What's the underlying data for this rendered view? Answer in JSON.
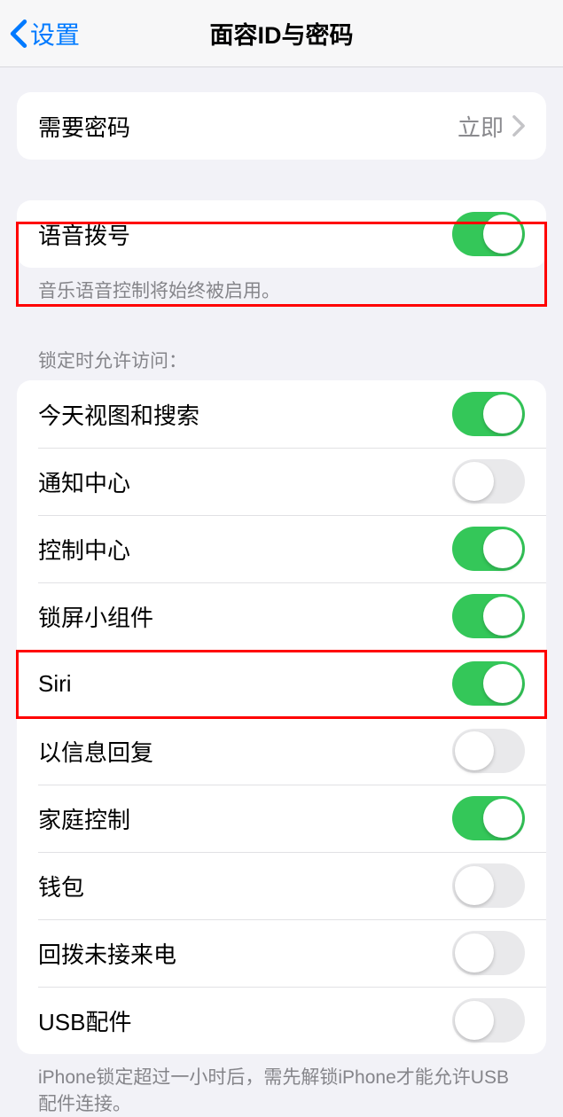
{
  "nav": {
    "back_label": "设置",
    "title": "面容ID与密码"
  },
  "passcode": {
    "label": "需要密码",
    "value": "立即"
  },
  "voice_dial": {
    "label": "语音拨号",
    "on": true,
    "footer": "音乐语音控制将始终被启用。"
  },
  "lock_access": {
    "header": "锁定时允许访问：",
    "items": [
      {
        "label": "今天视图和搜索",
        "on": true
      },
      {
        "label": "通知中心",
        "on": false
      },
      {
        "label": "控制中心",
        "on": true
      },
      {
        "label": "锁屏小组件",
        "on": true
      },
      {
        "label": "Siri",
        "on": true
      },
      {
        "label": "以信息回复",
        "on": false
      },
      {
        "label": "家庭控制",
        "on": true
      },
      {
        "label": "钱包",
        "on": false
      },
      {
        "label": "回拨未接来电",
        "on": false
      },
      {
        "label": "USB配件",
        "on": false
      }
    ],
    "footer": "iPhone锁定超过一小时后，需先解锁iPhone才能允许USB配件连接。"
  }
}
